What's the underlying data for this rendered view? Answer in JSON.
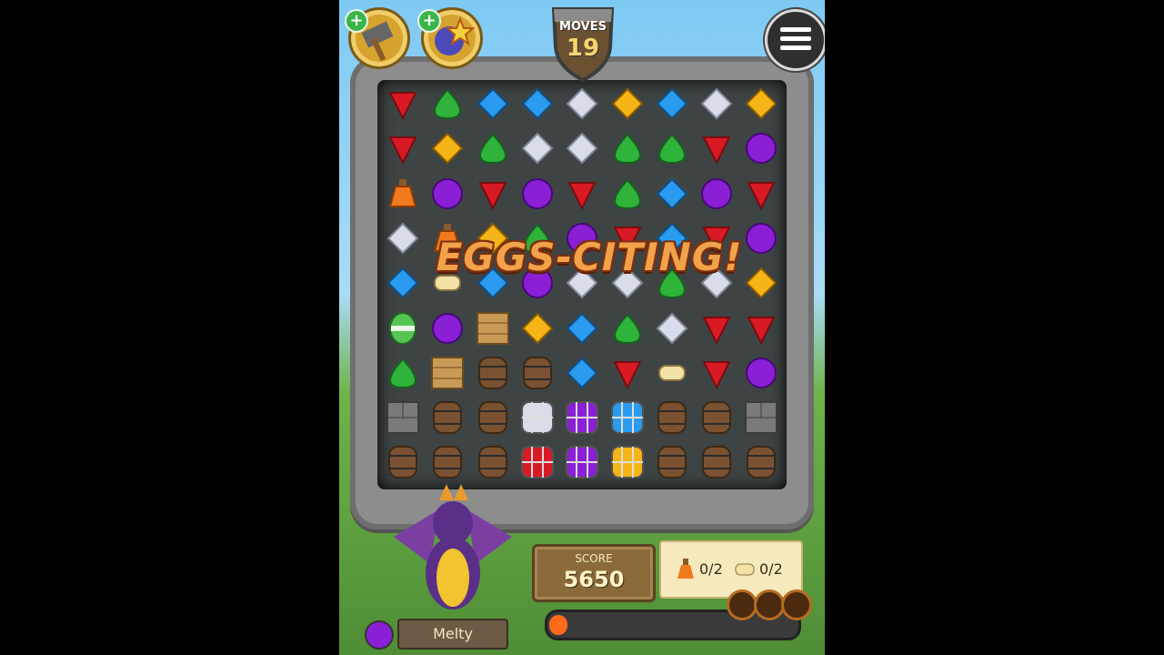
{
  "hud": {
    "moves_label": "MOVES",
    "moves_value": "19",
    "menu_icon": "hamburger-menu-icon",
    "boosters": [
      {
        "name": "hammer-booster-icon"
      },
      {
        "name": "wand-booster-icon"
      }
    ]
  },
  "banner": "EGGS-CITING!",
  "score": {
    "label": "SCORE",
    "value": "5650"
  },
  "goals": [
    {
      "icon": "potion-icon",
      "text": "0/2"
    },
    {
      "icon": "scroll-icon",
      "text": "0/2"
    }
  ],
  "progress": {
    "fraction": 0.06,
    "stars": 3
  },
  "character": {
    "name": "Melty"
  },
  "colors": {
    "red": "#d81a24",
    "green": "#2fb33b",
    "blue": "#2a9bef",
    "white": "#d9dde9",
    "yellow": "#f5b516",
    "purple": "#8a1fd6",
    "orange": "#f07a1e",
    "crate": "#c99a55",
    "barrel": "#7a5232",
    "cage": "#a9a9a9",
    "stone": "#7a7a7a",
    "egg": "#56c451",
    "scroll": "#f2e2a6"
  },
  "board": [
    [
      "red",
      "green",
      "blue",
      "blue",
      "white",
      "yellow",
      "blue",
      "white",
      "yellow"
    ],
    [
      "red",
      "yellow",
      "green",
      "white",
      "white",
      "green",
      "green",
      "red",
      "purple"
    ],
    [
      "potion",
      "purple",
      "red",
      "purple",
      "red",
      "green",
      "blue",
      "purple",
      "red"
    ],
    [
      "white",
      "potion",
      "yellow",
      "green",
      "purple",
      "red",
      "blue",
      "red",
      "purple"
    ],
    [
      "blue",
      "scroll",
      "blue",
      "purple",
      "white",
      "white",
      "green",
      "white",
      "yellow"
    ],
    [
      "egg",
      "purple",
      "crate",
      "yellow",
      "blue",
      "green",
      "white",
      "red",
      "red"
    ],
    [
      "green",
      "crate",
      "barrel",
      "barrel",
      "blue",
      "red",
      "scroll",
      "red",
      "purple"
    ],
    [
      "stone",
      "barrel",
      "barrel",
      "cage-white",
      "cage-purple",
      "cage-blue",
      "barrel",
      "barrel",
      "stone"
    ],
    [
      "barrel",
      "barrel",
      "barrel",
      "cage-red",
      "cage-purple",
      "cage-yellow",
      "barrel",
      "barrel",
      "barrel"
    ]
  ]
}
